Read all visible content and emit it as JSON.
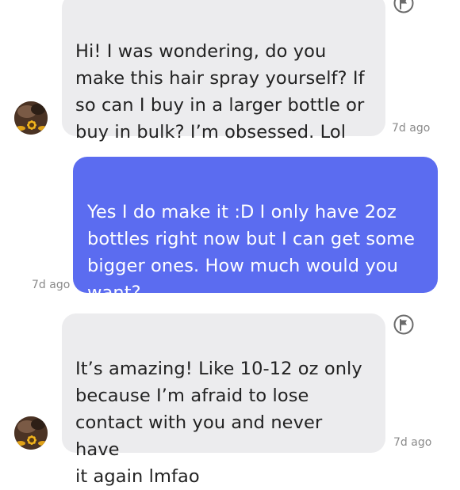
{
  "conversation": {
    "messages": [
      {
        "direction": "incoming",
        "text": "Hi! I was wondering, do you\nmake this hair spray yourself? If\nso can I buy in a larger bottle or\nbuy in bulk? I’m obsessed. Lol",
        "time": "7d ago"
      },
      {
        "direction": "outgoing",
        "text": "Yes I do make it :D I only have 2oz\nbottles right now but I can get some\nbigger ones. How much would you\nwant?",
        "time": "7d ago"
      },
      {
        "direction": "incoming",
        "text": "It’s amazing! Like 10-12 oz only\nbecause I’m afraid to lose\ncontact with you and never have\nit again lmfao",
        "time": "7d ago"
      }
    ]
  },
  "icons": {
    "report": "flag-icon",
    "avatar": "sunflower-avatar"
  },
  "colors": {
    "incoming_bubble": "#ececee",
    "outgoing_bubble": "#5b6cf0",
    "timestamp": "#8a8a8a"
  }
}
